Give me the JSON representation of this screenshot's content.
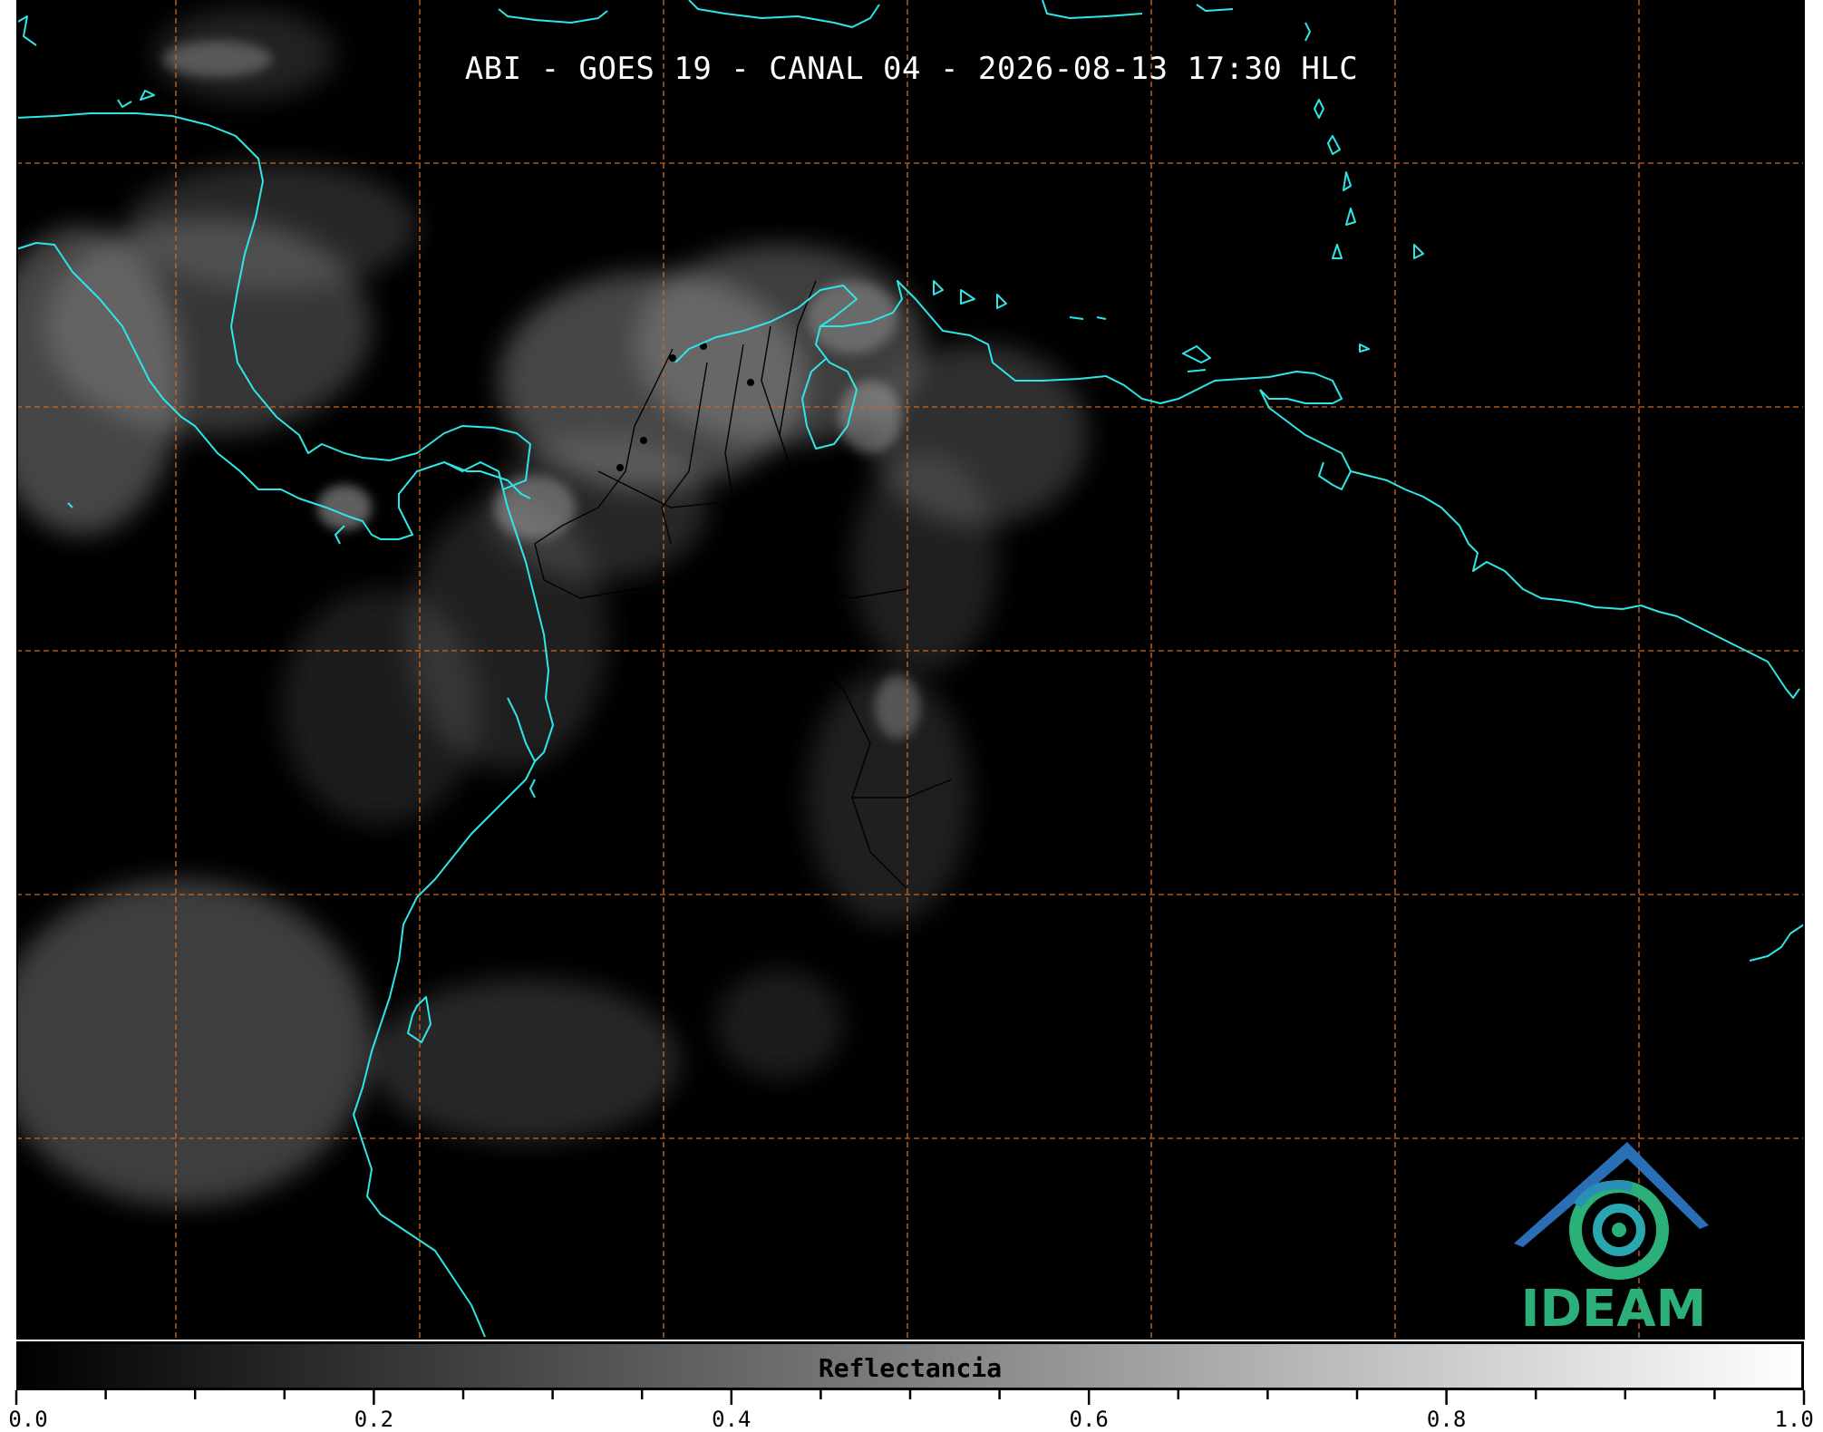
{
  "title": "ABI - GOES 19 - CANAL 04 - 2026-08-13 17:30 HLC",
  "colors": {
    "background": "#000000",
    "coastline": "#2ee6e6",
    "grid": "#c8661e",
    "borders": "#000000",
    "logo_green": "#2bb07a",
    "logo_blue": "#2a6fb5"
  },
  "colorbar": {
    "label": "Reflectancia",
    "range": [
      0.0,
      1.0
    ],
    "colormap": "grayscale black-to-white",
    "tick_labels": [
      "0.0",
      "0.2",
      "0.4",
      "0.6",
      "0.8",
      "1.0"
    ],
    "tick_values": [
      0.0,
      0.2,
      0.4,
      0.6,
      0.8,
      1.0
    ],
    "minor_tick_step": 0.05
  },
  "logo": {
    "text": "IDEAM",
    "icon": "ideam-mountain-spiral-logo"
  },
  "grid": {
    "style": "dashed",
    "columns": 7,
    "rows": 5
  }
}
